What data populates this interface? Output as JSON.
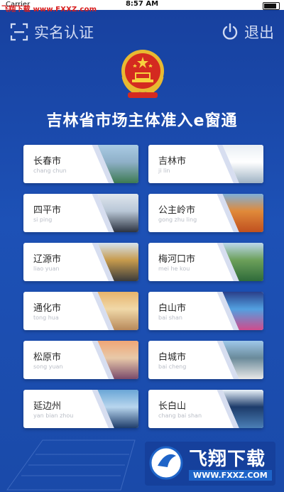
{
  "status_bar": {
    "carrier": "Carrier",
    "watermark": "飞翔下载 www.FXXZ.com",
    "time": "8:57 AM"
  },
  "topbar": {
    "realname_label": "实名认证",
    "logout_label": "退出"
  },
  "app_title": "吉林省市场主体准入e窗通",
  "cities": [
    {
      "name": "长春市",
      "pinyin": "chang chun",
      "photo_colors": [
        "#a9cbe4",
        "#3d7a52",
        "#8fb0c8"
      ]
    },
    {
      "name": "吉林市",
      "pinyin": "ji lin",
      "photo_colors": [
        "#e9eef4",
        "#9fb3c4",
        "#ffffff"
      ]
    },
    {
      "name": "四平市",
      "pinyin": "si ping",
      "photo_colors": [
        "#dfe6ee",
        "#2c3340",
        "#b9c7d6"
      ]
    },
    {
      "name": "公主岭市",
      "pinyin": "gong zhu ling",
      "photo_colors": [
        "#7fb0d8",
        "#c0501f",
        "#e08a3a"
      ]
    },
    {
      "name": "辽源市",
      "pinyin": "liao yuan",
      "photo_colors": [
        "#d6e3ef",
        "#3b3b3b",
        "#c79b4d"
      ]
    },
    {
      "name": "梅河口市",
      "pinyin": "mei he kou",
      "photo_colors": [
        "#bcd7ec",
        "#2f6b3a",
        "#6ca05a"
      ]
    },
    {
      "name": "通化市",
      "pinyin": "tong hua",
      "photo_colors": [
        "#e8b46c",
        "#b8895a",
        "#f0d8a8"
      ]
    },
    {
      "name": "白山市",
      "pinyin": "bai shan",
      "photo_colors": [
        "#2a3f8a",
        "#d04b8c",
        "#52a0e0"
      ]
    },
    {
      "name": "松原市",
      "pinyin": "song yuan",
      "photo_colors": [
        "#f0a676",
        "#7a4a6a",
        "#e8c9a9"
      ]
    },
    {
      "name": "白城市",
      "pinyin": "bai cheng",
      "photo_colors": [
        "#9ec8ea",
        "#e8e8e8",
        "#6a8a9a"
      ]
    },
    {
      "name": "延边州",
      "pinyin": "yan bian zhou",
      "photo_colors": [
        "#6aa6d6",
        "#1e3c6a",
        "#b8d6ee"
      ]
    },
    {
      "name": "长白山",
      "pinyin": "chang bai shan",
      "photo_colors": [
        "#eaf2fa",
        "#4b7fb6",
        "#1c3b6a"
      ]
    }
  ],
  "brand": {
    "big": "飞翔下载",
    "small": "WWW.FXXZ.COM"
  },
  "colors": {
    "background": "#1d51b6",
    "title": "#ffffff",
    "top_actions": "#cfd9f2"
  }
}
